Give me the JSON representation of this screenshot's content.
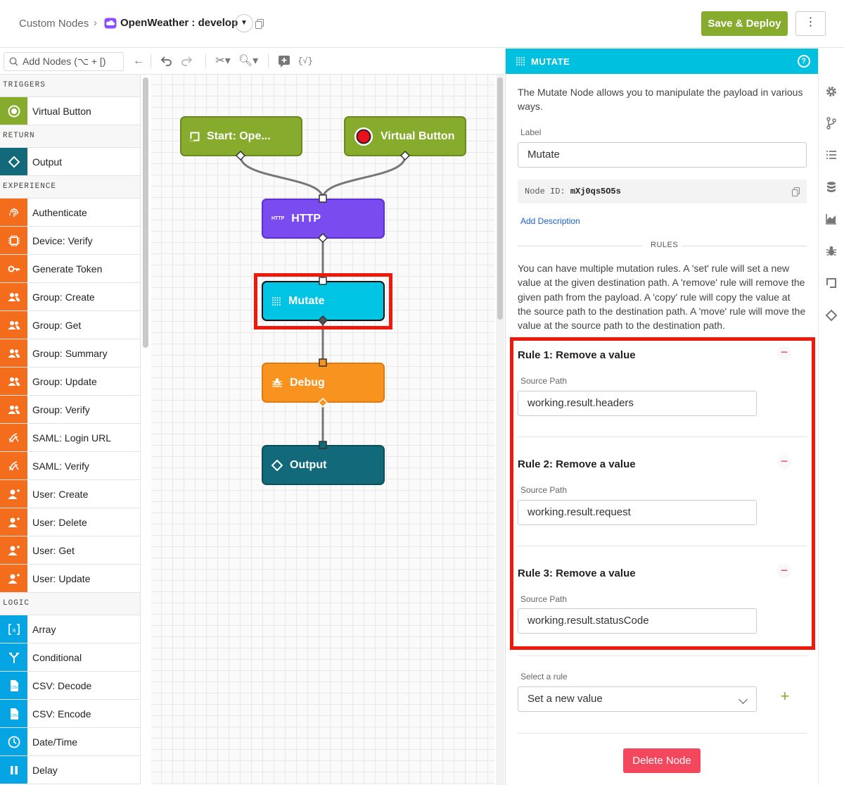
{
  "header": {
    "breadcrumb_root": "Custom Nodes",
    "breadcrumb_sep": "›",
    "current": "OpenWeather : develop",
    "save_deploy": "Save & Deploy",
    "more": "⋮"
  },
  "toolbar": {
    "search_placeholder": "Add Nodes (⌥ + [)"
  },
  "palette": {
    "sections": [
      {
        "title": "TRIGGERS",
        "items": [
          {
            "label": "Virtual Button",
            "icon": "virtual-button-icon",
            "color": "#86ab2d"
          }
        ]
      },
      {
        "title": "RETURN",
        "items": [
          {
            "label": "Output",
            "icon": "output-icon",
            "color": "#12697a"
          }
        ]
      },
      {
        "title": "EXPERIENCE",
        "items": [
          {
            "label": "Authenticate",
            "icon": "fingerprint-icon",
            "color": "#f46d1d"
          },
          {
            "label": "Device: Verify",
            "icon": "chip-icon",
            "color": "#f46d1d"
          },
          {
            "label": "Generate Token",
            "icon": "key-icon",
            "color": "#f46d1d"
          },
          {
            "label": "Group: Create",
            "icon": "group-add-icon",
            "color": "#f46d1d"
          },
          {
            "label": "Group: Get",
            "icon": "group-icon",
            "color": "#f46d1d"
          },
          {
            "label": "Group: Summary",
            "icon": "group-list-icon",
            "color": "#f46d1d"
          },
          {
            "label": "Group: Update",
            "icon": "group-edit-icon",
            "color": "#f46d1d"
          },
          {
            "label": "Group: Verify",
            "icon": "group-verify-icon",
            "color": "#f46d1d"
          },
          {
            "label": "SAML: Login URL",
            "icon": "saml-icon",
            "color": "#f46d1d"
          },
          {
            "label": "SAML: Verify",
            "icon": "saml-icon",
            "color": "#f46d1d"
          },
          {
            "label": "User: Create",
            "icon": "user-add-icon",
            "color": "#f46d1d"
          },
          {
            "label": "User: Delete",
            "icon": "user-remove-icon",
            "color": "#f46d1d"
          },
          {
            "label": "User: Get",
            "icon": "user-search-icon",
            "color": "#f46d1d"
          },
          {
            "label": "User: Update",
            "icon": "user-edit-icon",
            "color": "#f46d1d"
          }
        ]
      },
      {
        "title": "LOGIC",
        "items": [
          {
            "label": "Array",
            "icon": "array-icon",
            "color": "#05a4e3"
          },
          {
            "label": "Conditional",
            "icon": "branch-icon",
            "color": "#05a4e3"
          },
          {
            "label": "CSV: Decode",
            "icon": "csv-icon",
            "color": "#05a4e3"
          },
          {
            "label": "CSV: Encode",
            "icon": "csv-icon",
            "color": "#05a4e3"
          },
          {
            "label": "Date/Time",
            "icon": "clock-icon",
            "color": "#05a4e3"
          },
          {
            "label": "Delay",
            "icon": "pause-icon",
            "color": "#05a4e3"
          }
        ]
      }
    ]
  },
  "canvas": {
    "nodes": {
      "start": "Start: Ope...",
      "virtual_button": "Virtual Button",
      "http": "HTTP",
      "http_badge": "HTTP",
      "mutate": "Mutate",
      "debug": "Debug",
      "output": "Output"
    },
    "colors": {
      "trigger": "#86ab2d",
      "http": "#7a4cf0",
      "mutate": "#00c4e3",
      "debug": "#f7931e",
      "output": "#12697a",
      "highlight": "#f0170b"
    }
  },
  "panel": {
    "title": "MUTATE",
    "help": "?",
    "description": "The Mutate Node allows you to manipulate the payload in various ways.",
    "label_label": "Label",
    "label_value": "Mutate",
    "node_id_prefix": "Node ID: ",
    "node_id": "mXj0qs5O5s",
    "add_description": "Add Description",
    "rules_title": "RULES",
    "rules_help": "You can have multiple mutation rules. A 'set' rule will set a new value at the given destination path. A 'remove' rule will remove the given path from the payload. A 'copy' rule will copy the value at the source path to the destination path. A 'move' rule will move the value at the source path to the destination path.",
    "rules": [
      {
        "title": "Rule 1: Remove a value",
        "field_label": "Source Path",
        "value": "working.result.headers"
      },
      {
        "title": "Rule 2: Remove a value",
        "field_label": "Source Path",
        "value": "working.result.request"
      },
      {
        "title": "Rule 3: Remove a value",
        "field_label": "Source Path",
        "value": "working.result.statusCode"
      }
    ],
    "select_label": "Select a rule",
    "select_value": "Set a new value",
    "delete": "Delete Node"
  }
}
